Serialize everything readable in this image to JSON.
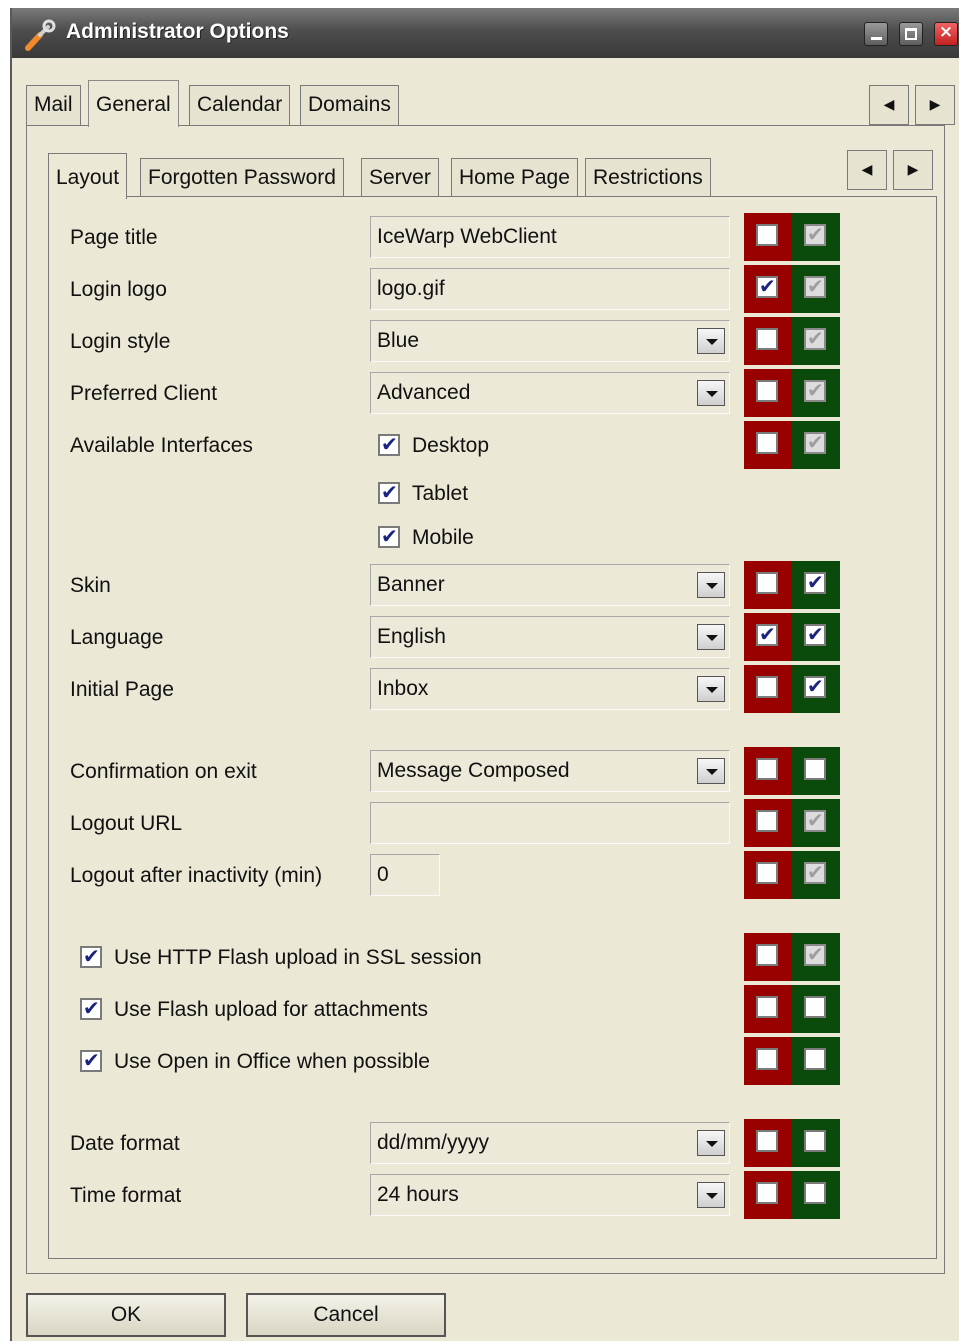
{
  "window": {
    "title": "Administrator Options",
    "icon": "wrench-icon"
  },
  "outer_tabs": [
    "Mail",
    "General",
    "Calendar",
    "Domains"
  ],
  "outer_active": "General",
  "inner_tabs": [
    "Layout",
    "Forgotten Password",
    "Server",
    "Home Page",
    "Restrictions"
  ],
  "inner_active": "Layout",
  "colors": {
    "deny_lock": "#990000",
    "allow_lock": "#0a4a0a",
    "titlebar": "#4d4d4d",
    "panel": "#ebe8d6"
  },
  "fields": {
    "page_title": {
      "label": "Page title",
      "value": "IceWarp WebClient",
      "lock_red": false,
      "lock_green": true
    },
    "login_logo": {
      "label": "Login logo",
      "value": "logo.gif",
      "lock_red": true,
      "lock_green": true
    },
    "login_style": {
      "label": "Login style",
      "value": "Blue",
      "lock_red": false,
      "lock_green": true
    },
    "preferred_client": {
      "label": "Preferred Client",
      "value": "Advanced",
      "lock_red": false,
      "lock_green": true
    },
    "available_interfaces": {
      "label": "Available Interfaces",
      "options": [
        {
          "label": "Desktop",
          "checked": true
        },
        {
          "label": "Tablet",
          "checked": true
        },
        {
          "label": "Mobile",
          "checked": true
        }
      ],
      "lock_red": false,
      "lock_green": true
    },
    "skin": {
      "label": "Skin",
      "value": "Banner",
      "lock_red": false,
      "lock_green": true
    },
    "language": {
      "label": "Language",
      "value": "English",
      "lock_red": true,
      "lock_green": true
    },
    "initial_page": {
      "label": "Initial Page",
      "value": "Inbox",
      "lock_red": false,
      "lock_green": true
    },
    "confirmation_on_exit": {
      "label": "Confirmation on exit",
      "value": "Message Composed",
      "lock_red": false,
      "lock_green": false
    },
    "logout_url": {
      "label": "Logout URL",
      "value": "",
      "lock_red": false,
      "lock_green": true
    },
    "logout_after_inactivity": {
      "label": "Logout after inactivity (min)",
      "value": "0",
      "lock_red": false,
      "lock_green": true
    },
    "http_flash_ssl": {
      "label": "Use HTTP Flash upload in SSL session",
      "checked": true,
      "lock_red": false,
      "lock_green": true
    },
    "flash_attachments": {
      "label": "Use Flash upload for attachments",
      "checked": true,
      "lock_red": false,
      "lock_green": false
    },
    "open_in_office": {
      "label": "Use Open in Office when possible",
      "checked": true,
      "lock_red": false,
      "lock_green": false
    },
    "date_format": {
      "label": "Date format",
      "value": "dd/mm/yyyy",
      "lock_red": false,
      "lock_green": false
    },
    "time_format": {
      "label": "Time format",
      "value": "24 hours",
      "lock_red": false,
      "lock_green": false
    }
  },
  "buttons": {
    "ok": "OK",
    "cancel": "Cancel"
  }
}
